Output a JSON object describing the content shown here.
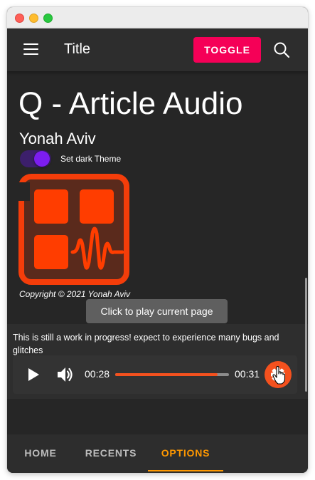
{
  "appbar": {
    "title": "Title",
    "toggle_label": "TOGGLE"
  },
  "article": {
    "heading": "Q - Article Audio",
    "author": "Yonah Aviv",
    "theme_switch_label": "Set dark Theme",
    "theme_switch_on": true,
    "copyright": "Copyright © 2021 Yonah Aviv"
  },
  "tooltip": {
    "text": "Click to play current page"
  },
  "notice": {
    "text": "This is still a work in progress! expect to experience many bugs and glitches"
  },
  "player": {
    "current_time": "00:28",
    "total_time": "00:31",
    "progress": 0.9
  },
  "bottom_nav": {
    "tabs": [
      {
        "label": "HOME",
        "active": false
      },
      {
        "label": "RECENTS",
        "active": false
      },
      {
        "label": "OPTIONS",
        "active": true
      }
    ]
  },
  "icons": {
    "menu": "menu-icon",
    "search": "search-icon",
    "play": "play-icon",
    "volume": "volume-icon",
    "settings": "gear-icon",
    "logo": "app-logo-icon"
  },
  "colors": {
    "accent_pink": "#f50057",
    "accent_orange": "#f4511e",
    "active_tab": "#ff9800",
    "switch_thumb": "#7c1df0",
    "background": "#262626"
  }
}
